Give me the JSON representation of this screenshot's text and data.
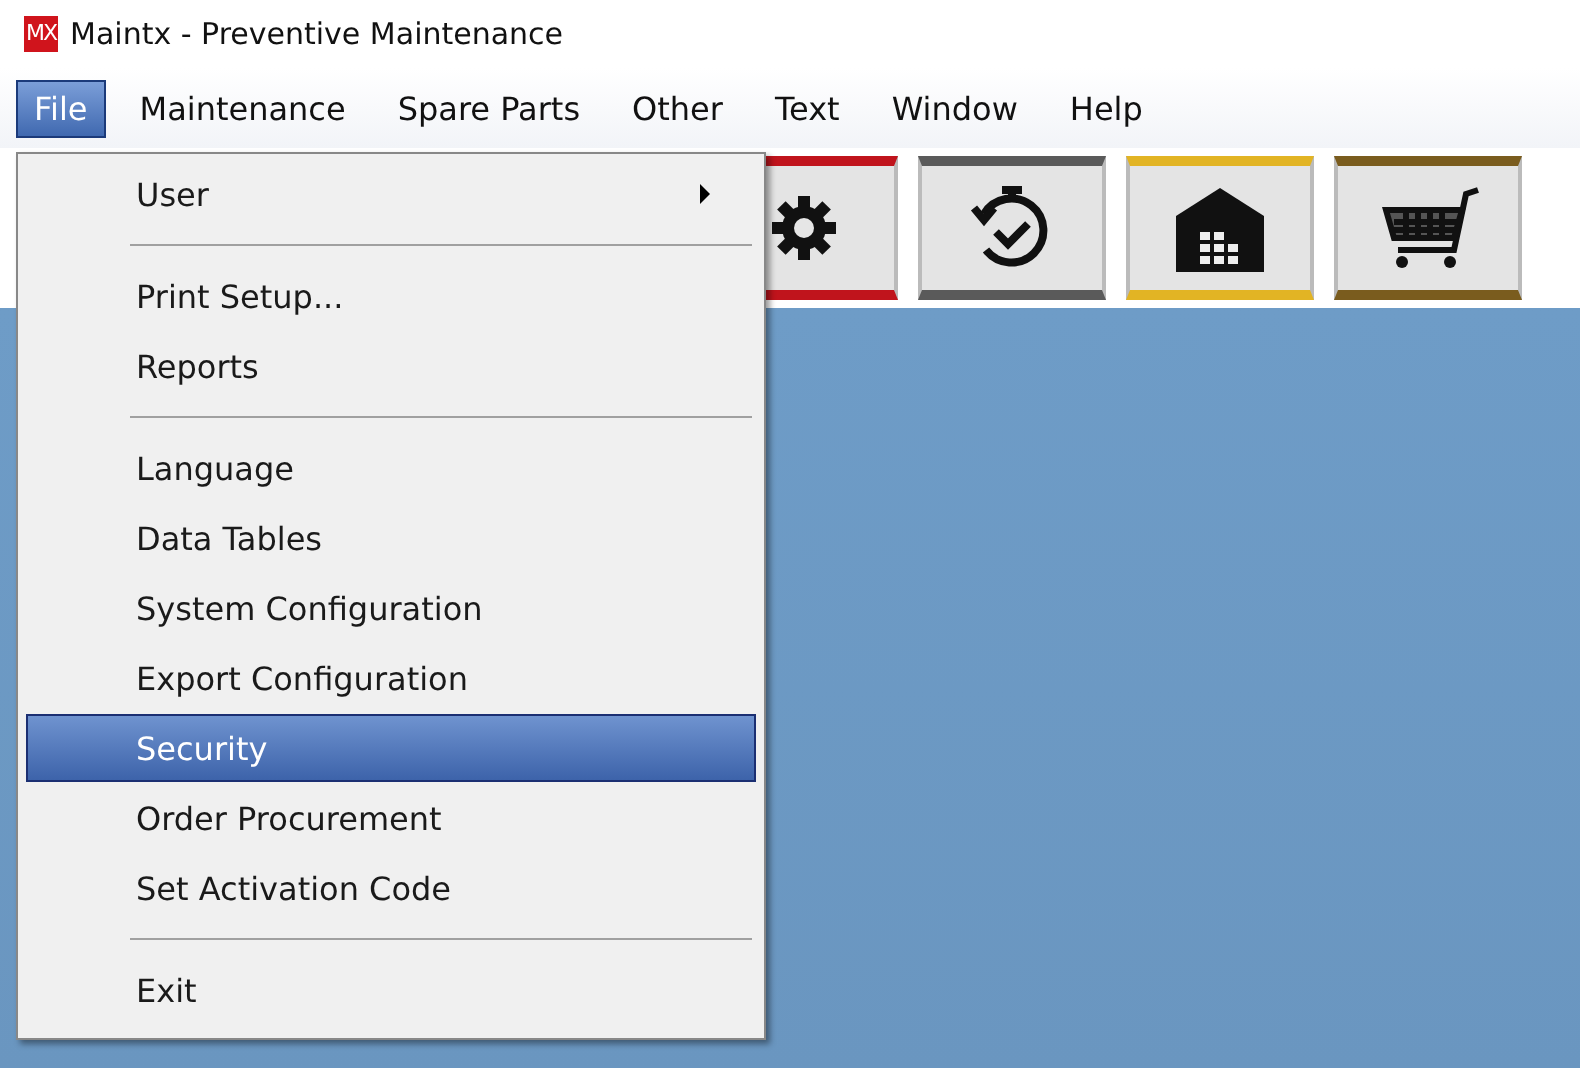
{
  "window": {
    "logo": "MX",
    "title": "Maintx - Preventive Maintenance"
  },
  "menu_bar": [
    {
      "label": "File",
      "selected": true
    },
    {
      "label": "Maintenance",
      "selected": false
    },
    {
      "label": "Spare Parts",
      "selected": false
    },
    {
      "label": "Other",
      "selected": false
    },
    {
      "label": "Text",
      "selected": false
    },
    {
      "label": "Window",
      "selected": false
    },
    {
      "label": "Help",
      "selected": false
    }
  ],
  "toolbar": [
    {
      "kind": "gear",
      "color": "#c0141c"
    },
    {
      "kind": "stopwatch",
      "color": "#5a5a5a"
    },
    {
      "kind": "warehouse",
      "color": "#e2b424"
    },
    {
      "kind": "cart",
      "color": "#7a5c1e"
    }
  ],
  "file_menu": [
    {
      "kind": "item",
      "label": "User",
      "selected": false,
      "submenu": true
    },
    {
      "kind": "separator"
    },
    {
      "kind": "item",
      "label": "Print Setup...",
      "selected": false,
      "submenu": false
    },
    {
      "kind": "item",
      "label": "Reports",
      "selected": false,
      "submenu": false
    },
    {
      "kind": "separator"
    },
    {
      "kind": "item",
      "label": "Language",
      "selected": false,
      "submenu": false
    },
    {
      "kind": "item",
      "label": "Data Tables",
      "selected": false,
      "submenu": false
    },
    {
      "kind": "item",
      "label": "System Configuration",
      "selected": false,
      "submenu": false
    },
    {
      "kind": "item",
      "label": "Export Configuration",
      "selected": false,
      "submenu": false
    },
    {
      "kind": "item",
      "label": "Security",
      "selected": true,
      "submenu": false
    },
    {
      "kind": "item",
      "label": "Order Procurement",
      "selected": false,
      "submenu": false
    },
    {
      "kind": "item",
      "label": "Set Activation Code",
      "selected": false,
      "submenu": false
    },
    {
      "kind": "separator"
    },
    {
      "kind": "item",
      "label": "Exit",
      "selected": false,
      "submenu": false
    }
  ]
}
